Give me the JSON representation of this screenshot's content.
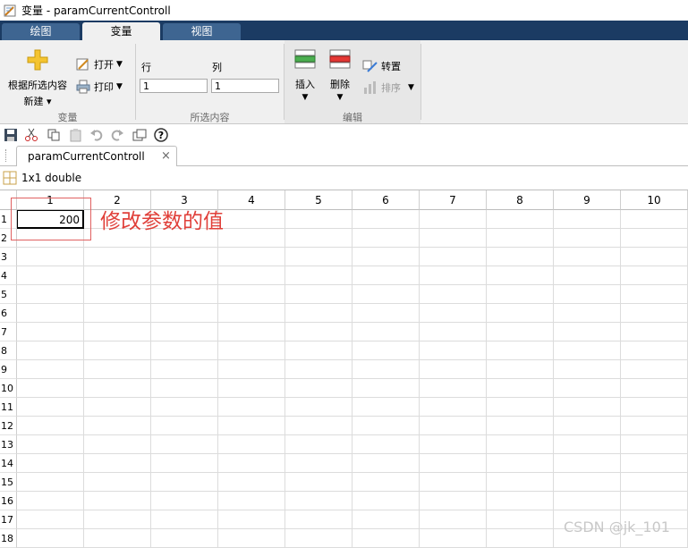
{
  "window": {
    "title": "变量 - paramCurrentControll"
  },
  "tabs": [
    {
      "label": "绘图",
      "active": false
    },
    {
      "label": "变量",
      "active": true
    },
    {
      "label": "视图",
      "active": false
    }
  ],
  "ribbon": {
    "variable_group": {
      "label": "变量",
      "new_from_selection": "根据所选内容",
      "new_label": "新建",
      "open_label": "打开",
      "print_label": "打印"
    },
    "selection_group": {
      "label": "所选内容",
      "row_label": "行",
      "col_label": "列",
      "row_value": "1",
      "col_value": "1"
    },
    "edit_group": {
      "label": "编辑",
      "insert_label": "插入",
      "delete_label": "删除",
      "transpose_label": "转置",
      "sort_label": "排序"
    }
  },
  "doc_tab": {
    "label": "paramCurrentControll",
    "close": "×"
  },
  "info": {
    "text": "1x1 double"
  },
  "grid": {
    "columns": [
      "1",
      "2",
      "3",
      "4",
      "5",
      "6",
      "7",
      "8",
      "9",
      "10"
    ],
    "rows": [
      "1",
      "2",
      "3",
      "4",
      "5",
      "6",
      "7",
      "8",
      "9",
      "10",
      "11",
      "12",
      "13",
      "14",
      "15",
      "16",
      "17",
      "18"
    ],
    "cell_1_1": "200"
  },
  "annotation": {
    "text": "修改参数的值"
  },
  "watermark": {
    "text": "CSDN @jk_101"
  },
  "colors": {
    "tabstrip": "#1b3b63",
    "tab": "#3e6591",
    "annotation": "#e0403a"
  }
}
